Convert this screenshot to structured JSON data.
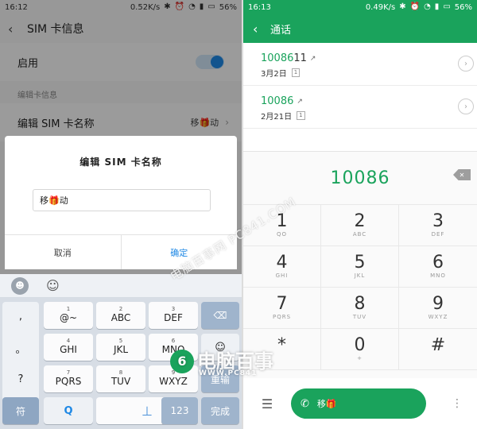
{
  "left": {
    "status": {
      "time": "16:12",
      "speed": "0.52K/s",
      "battery": "56%"
    },
    "appbar": {
      "title": "SIM 卡信息"
    },
    "enable_row": {
      "label": "启用"
    },
    "section_header": "编辑卡信息",
    "name_row": {
      "label": "编辑 SIM 卡名称",
      "value": "移🎁动"
    },
    "dialog": {
      "title": "编辑 SIM 卡名称",
      "input_value": "移🎁动",
      "cancel": "取消",
      "ok": "确定"
    },
    "keyboard": {
      "side_col": [
        ",",
        "。",
        "?",
        "!"
      ],
      "rows": [
        [
          {
            "num": "1",
            "let": "@~"
          },
          {
            "num": "2",
            "let": "ABC"
          },
          {
            "num": "3",
            "let": "DEF"
          }
        ],
        [
          {
            "num": "4",
            "let": "GHI"
          },
          {
            "num": "5",
            "let": "JKL"
          },
          {
            "num": "6",
            "let": "MNO"
          }
        ],
        [
          {
            "num": "7",
            "let": "PQRS"
          },
          {
            "num": "8",
            "let": "TUV"
          },
          {
            "num": "9",
            "let": "WXYZ"
          }
        ]
      ],
      "reenter": "重输",
      "symbol": "符",
      "numeric": "123",
      "done": "完成"
    }
  },
  "right": {
    "status": {
      "time": "16:13",
      "speed": "0.49K/s",
      "battery": "56%"
    },
    "appbar": {
      "title": "通话"
    },
    "calls": [
      {
        "number": "10086",
        "number_suffix": "11",
        "date": "3月2日",
        "sim": "1"
      },
      {
        "number": "10086",
        "number_suffix": "",
        "date": "2月21日",
        "sim": "1"
      }
    ],
    "dial_display": "10086",
    "pad": [
      {
        "d": "1",
        "l": "QO"
      },
      {
        "d": "2",
        "l": "ABC"
      },
      {
        "d": "3",
        "l": "DEF"
      },
      {
        "d": "4",
        "l": "GHI"
      },
      {
        "d": "5",
        "l": "JKL"
      },
      {
        "d": "6",
        "l": "MNO"
      },
      {
        "d": "7",
        "l": "PQRS"
      },
      {
        "d": "8",
        "l": "TUV"
      },
      {
        "d": "9",
        "l": "WXYZ"
      },
      {
        "d": "*",
        "l": ""
      },
      {
        "d": "0",
        "l": "+"
      },
      {
        "d": "#",
        "l": ""
      }
    ],
    "call_button_label": "移🎁"
  },
  "watermark": {
    "text": "电脑百事",
    "sub": "WWW.PC841",
    "diag": "电脑百事网 PC841.COM"
  },
  "colors": {
    "green": "#1aa35c",
    "blue": "#1e88e5"
  }
}
